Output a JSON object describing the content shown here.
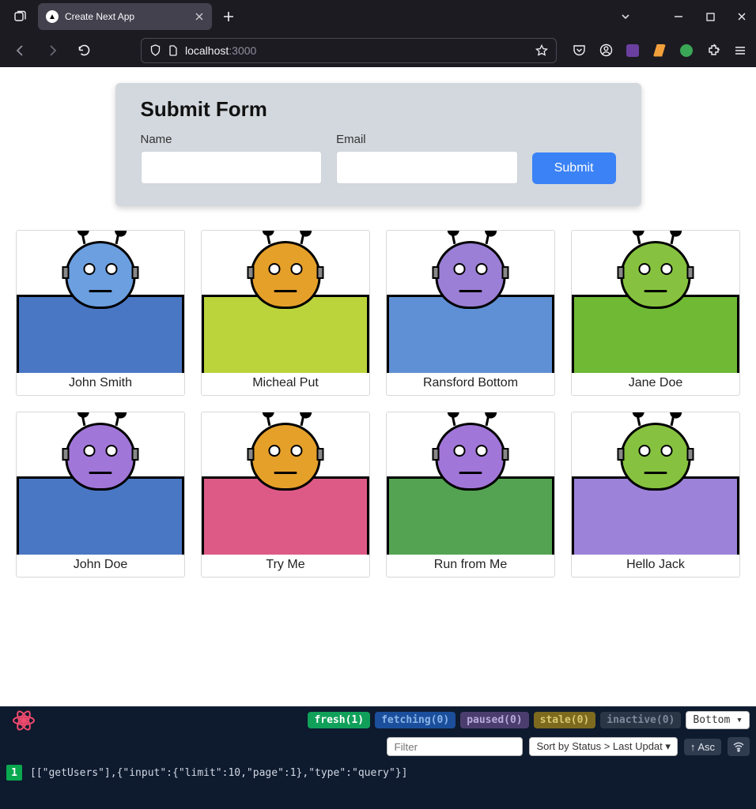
{
  "browser": {
    "tab_title": "Create Next App",
    "url_host": "localhost",
    "url_port": ":3000"
  },
  "form": {
    "title": "Submit Form",
    "name_label": "Name",
    "email_label": "Email",
    "submit_label": "Submit",
    "name_value": "",
    "email_value": ""
  },
  "users": [
    {
      "name": "John Smith",
      "head": "#6b9fe0",
      "body": "#4a77c4"
    },
    {
      "name": "Micheal Put",
      "head": "#e5a02a",
      "body": "#bcd43b"
    },
    {
      "name": "Ransford Bottom",
      "head": "#9b7fd6",
      "body": "#5f8fd4"
    },
    {
      "name": "Jane Doe",
      "head": "#86c23f",
      "body": "#6fb934"
    },
    {
      "name": "John Doe",
      "head": "#a176d9",
      "body": "#4a77c4"
    },
    {
      "name": "Try Me",
      "head": "#e5a02a",
      "body": "#dd5a87"
    },
    {
      "name": "Run from Me",
      "head": "#a176d9",
      "body": "#54a352"
    },
    {
      "name": "Hello Jack",
      "head": "#86c23f",
      "body": "#9c82d9"
    }
  ],
  "devtools": {
    "badges": {
      "fresh": {
        "label": "fresh",
        "count": "(1)"
      },
      "fetching": {
        "label": "fetching",
        "count": "(0)"
      },
      "paused": {
        "label": "paused",
        "count": "(0)"
      },
      "stale": {
        "label": "stale",
        "count": "(0)"
      },
      "inactive": {
        "label": "inactive",
        "count": "(0)"
      }
    },
    "position_select": "Bottom",
    "filter_placeholder": "Filter",
    "sort_label": "Sort by Status > Last Updat",
    "asc_label": "↑ Asc",
    "query_count": "1",
    "query_text": "[[\"getUsers\"],{\"input\":{\"limit\":10,\"page\":1},\"type\":\"query\"}]"
  }
}
